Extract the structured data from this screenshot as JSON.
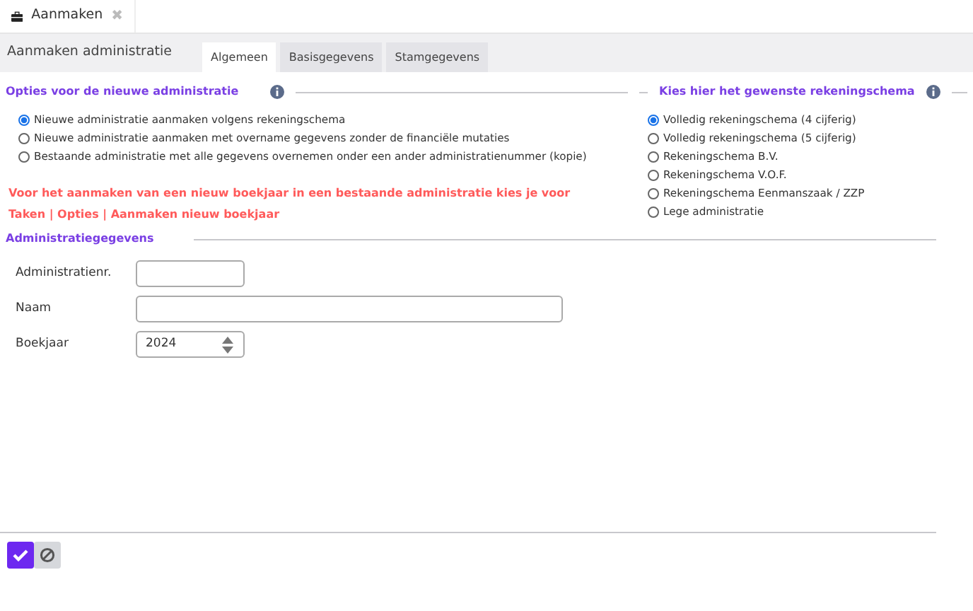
{
  "doc_tab": {
    "label": "Aanmaken",
    "close": "✖"
  },
  "header": {
    "title": "Aanmaken administratie"
  },
  "tabs": [
    {
      "label": "Algemeen",
      "selected": true
    },
    {
      "label": "Basisgegevens",
      "selected": false
    },
    {
      "label": "Stamgegevens",
      "selected": false
    }
  ],
  "options": {
    "title": "Opties voor de nieuwe administratie",
    "items": [
      {
        "label": "Nieuwe administratie aanmaken volgens rekeningschema",
        "selected": true
      },
      {
        "label": "Nieuwe administratie aanmaken met overname gegevens zonder de financiële mutaties",
        "selected": false
      },
      {
        "label": "Bestaande administratie met alle gegevens overnemen onder een ander administratienummer (kopie)",
        "selected": false
      }
    ],
    "notice": [
      "Voor het aanmaken van een nieuw boekjaar in een bestaande administratie kies je voor",
      "Taken | Opties | Aanmaken nieuw boekjaar"
    ]
  },
  "schema": {
    "title": "Kies hier het gewenste rekeningschema",
    "items": [
      {
        "label": "Volledig rekeningschema (4 cijferig)",
        "selected": true
      },
      {
        "label": "Volledig rekeningschema (5 cijferig)",
        "selected": false
      },
      {
        "label": "Rekeningschema B.V.",
        "selected": false
      },
      {
        "label": "Rekeningschema V.O.F.",
        "selected": false
      },
      {
        "label": "Rekeningschema Eenmanszaak / ZZP",
        "selected": false
      },
      {
        "label": "Lege administratie",
        "selected": false
      }
    ]
  },
  "details": {
    "title": "Administratiegegevens",
    "fields": [
      {
        "label": "Administratienr.",
        "kind": "code"
      },
      {
        "label": "Naam",
        "kind": "text"
      },
      {
        "label": "Boekjaar",
        "kind": "number",
        "value": "2024"
      }
    ]
  }
}
